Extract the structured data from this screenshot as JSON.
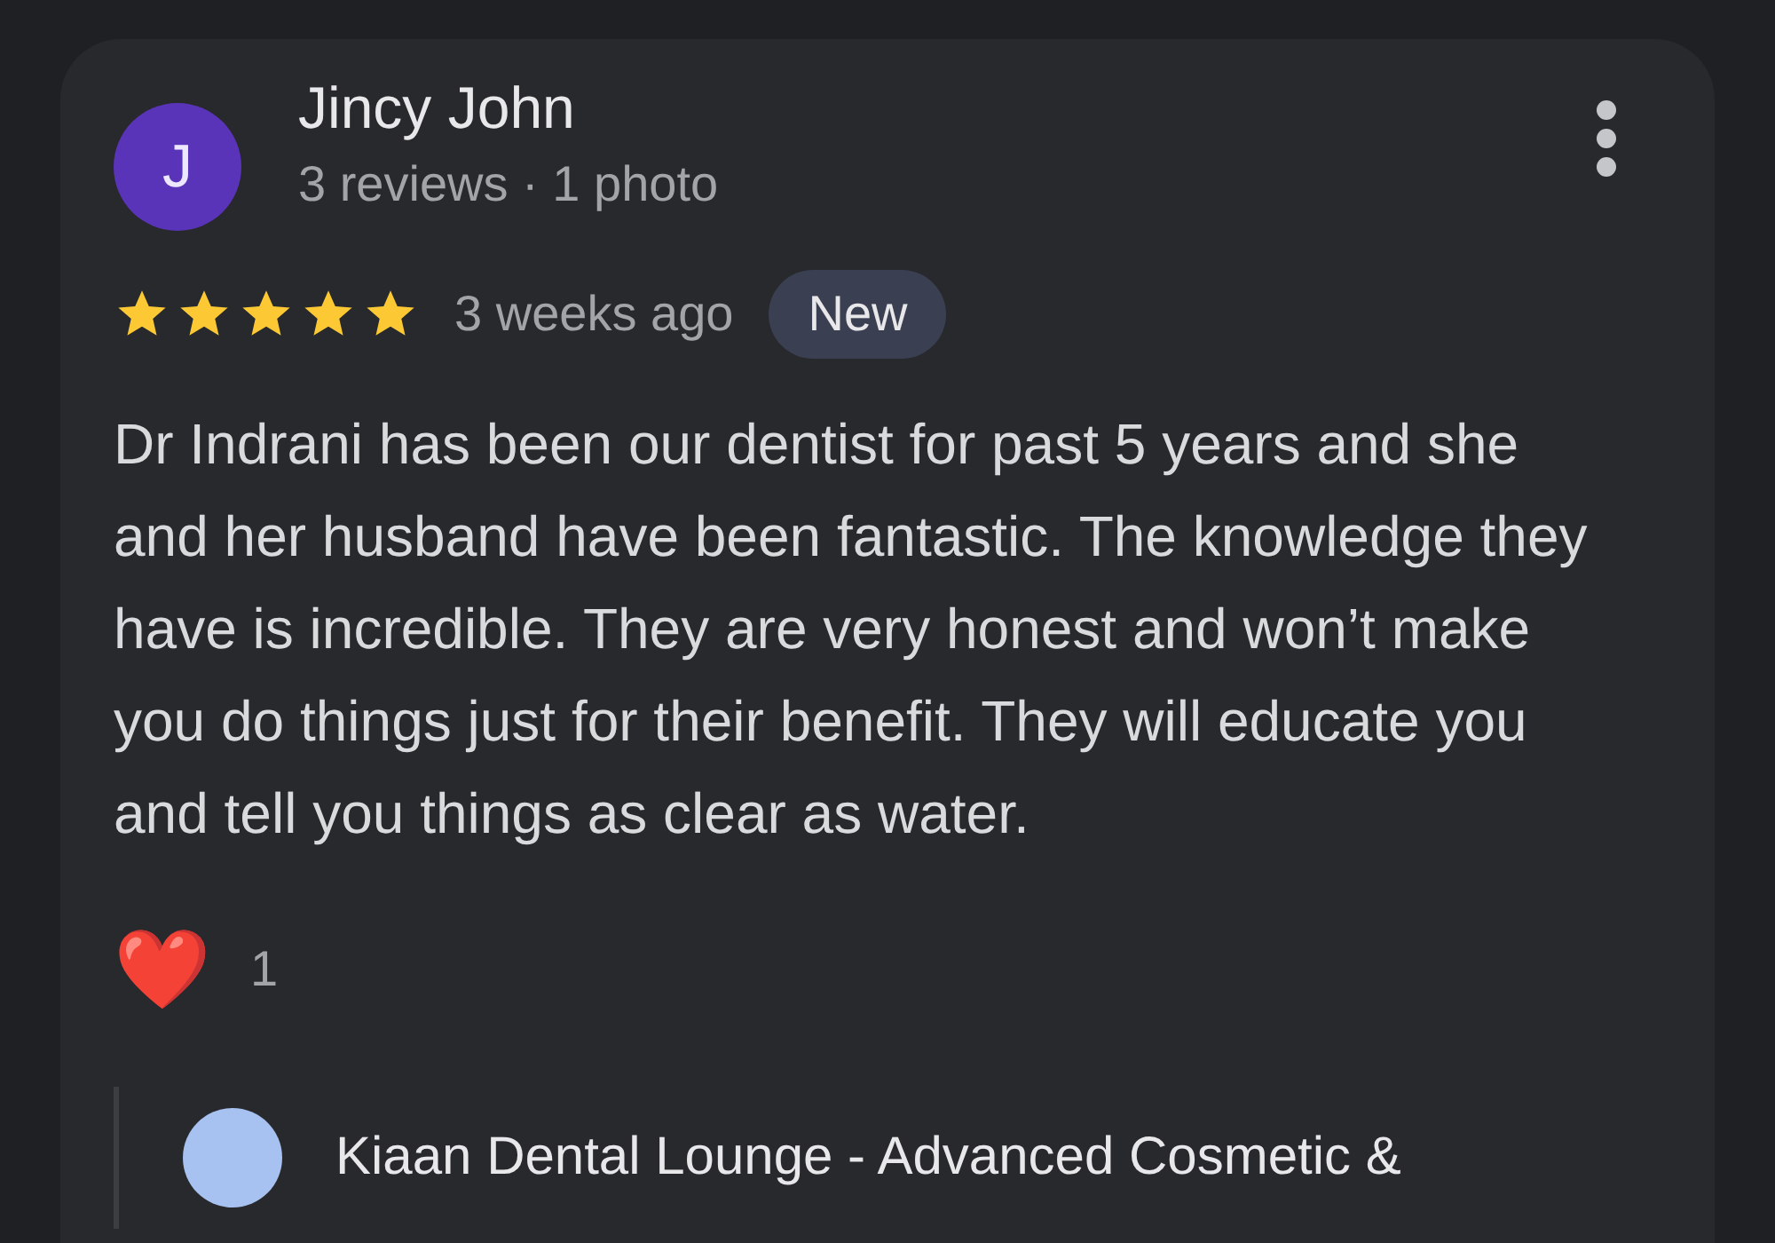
{
  "review": {
    "avatar_letter": "J",
    "author": "Jincy John",
    "meta": "3 reviews · 1 photo",
    "stars": 5,
    "time": "3 weeks ago",
    "badge": "New",
    "text": "Dr Indrani has been our dentist for past 5 years and she and her husband have been fantastic. The knowledge they have is incredible. They are very honest and won’t make you do things just for their benefit. They will educate you and tell you things as clear as water.",
    "reaction": {
      "emoji": "❤️",
      "count": "1"
    }
  },
  "owner_reply": {
    "name": "Kiaan Dental Lounge - Advanced Cosmetic &"
  }
}
